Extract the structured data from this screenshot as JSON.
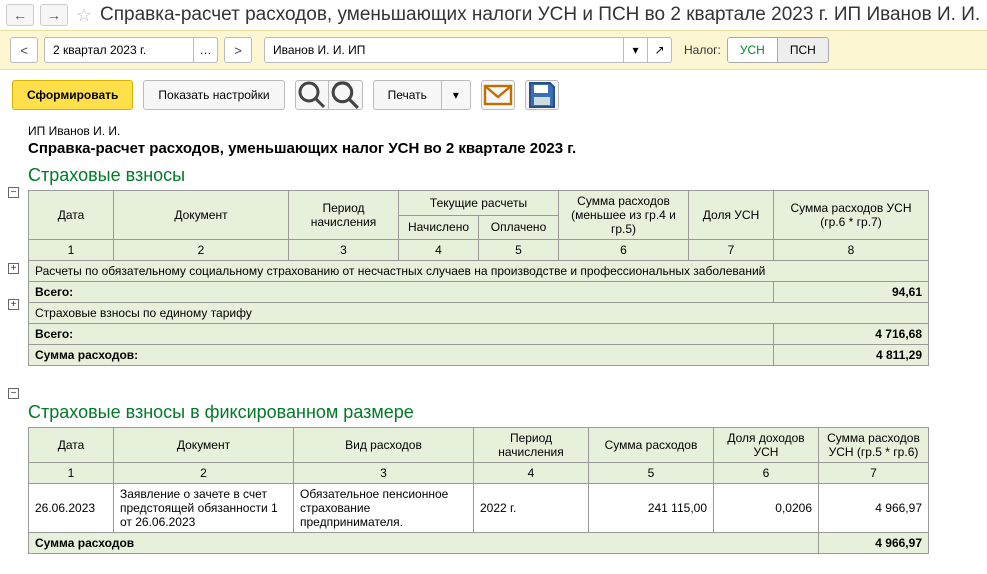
{
  "header": {
    "title": "Справка-расчет расходов, уменьшающих налоги УСН и ПСН во 2 квартале 2023 г. ИП Иванов И. И."
  },
  "filter": {
    "period": "2 квартал 2023 г.",
    "org": "Иванов И. И. ИП",
    "tax_label": "Налог:",
    "tax_usn": "УСН",
    "tax_psn": "ПСН"
  },
  "toolbar": {
    "generate": "Сформировать",
    "show_settings": "Показать настройки",
    "print": "Печать"
  },
  "report": {
    "owner": "ИП Иванов И. И.",
    "title": "Справка-расчет расходов, уменьшающих налог УСН во 2 квартале 2023 г.",
    "section1": {
      "title": "Страховые взносы",
      "headers": {
        "date": "Дата",
        "doc": "Документ",
        "period": "Период начисления",
        "current": "Текущие расчеты",
        "accrued": "Начислено",
        "paid": "Оплачено",
        "sum": "Сумма расходов (меньшее из гр.4 и гр.5)",
        "share": "Доля УСН",
        "usn": "Сумма расходов УСН (гр.6 * гр.7)"
      },
      "cols": {
        "c1": "1",
        "c2": "2",
        "c3": "3",
        "c4": "4",
        "c5": "5",
        "c6": "6",
        "c7": "7",
        "c8": "8"
      },
      "group1": {
        "label": "Расчеты по обязательному социальному страхованию от несчастных случаев на производстве и профессиональных заболеваний",
        "total_label": "Всего:",
        "total_value": "94,61"
      },
      "group2": {
        "label": "Страховые взносы по единому тарифу",
        "total_label": "Всего:",
        "total_value": "4 716,68"
      },
      "sum_label": "Сумма расходов:",
      "sum_value": "4 811,29"
    },
    "section2": {
      "title": "Страховые взносы в фиксированном размере",
      "headers": {
        "date": "Дата",
        "doc": "Документ",
        "kind": "Вид расходов",
        "period": "Период начисления",
        "sum": "Сумма расходов",
        "share": "Доля доходов УСН",
        "usn": "Сумма расходов УСН (гр.5 * гр.6)"
      },
      "cols": {
        "c1": "1",
        "c2": "2",
        "c3": "3",
        "c4": "4",
        "c5": "5",
        "c6": "6",
        "c7": "7"
      },
      "row": {
        "date": "26.06.2023",
        "doc": "Заявление о зачете в счет предстоящей обязанности 1 от 26.06.2023",
        "kind": "Обязательное пенсионное страхование предпринимателя.",
        "period": "2022 г.",
        "sum": "241 115,00",
        "share": "0,0206",
        "usn": "4 966,97"
      },
      "sum_label": "Сумма расходов",
      "sum_value": "4 966,97"
    }
  }
}
